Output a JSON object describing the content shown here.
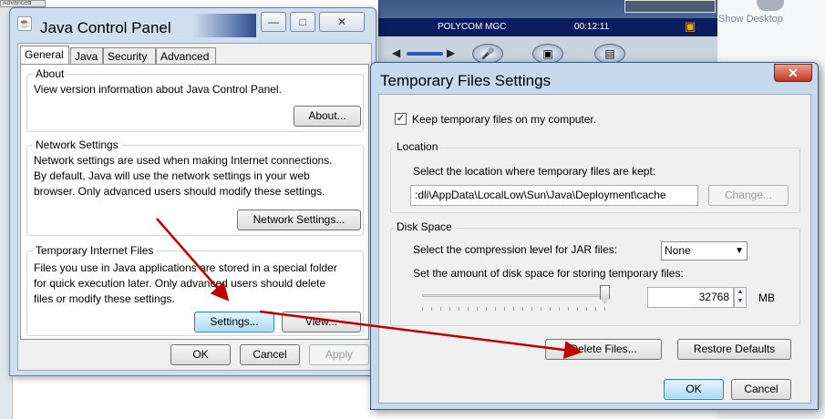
{
  "background": {
    "left_tab_label": "Advanced",
    "video_call_name": "POLYCOM MGC",
    "video_call_time": "00:12:11",
    "show_desktop_label": "Show Desktop"
  },
  "java_control_panel": {
    "title": "Java Control Panel",
    "tabs": [
      {
        "label": "General",
        "active": true
      },
      {
        "label": "Java",
        "active": false
      },
      {
        "label": "Security",
        "active": false
      },
      {
        "label": "Advanced",
        "active": false
      }
    ],
    "about": {
      "heading": "About",
      "text": "View version information about Java Control Panel.",
      "button": "About..."
    },
    "network": {
      "heading": "Network Settings",
      "text_lines": [
        "Network settings are used when making Internet connections.",
        "By default, Java will use the network settings in your web",
        "browser.  Only advanced users should modify these settings."
      ],
      "button": "Network Settings..."
    },
    "temp_files": {
      "heading": "Temporary Internet Files",
      "text_lines": [
        "Files you use in Java applications are stored in a special folder",
        "for quick execution later.  Only advanced users should delete",
        "files or modify these settings."
      ],
      "settings_button": "Settings...",
      "view_button": "View..."
    },
    "footer": {
      "ok": "OK",
      "cancel": "Cancel",
      "apply": "Apply"
    }
  },
  "temporary_files_dialog": {
    "title": "Temporary Files Settings",
    "keep_files_label": "Keep temporary files on my computer.",
    "keep_files_checked": true,
    "location": {
      "legend": "Location",
      "prompt": "Select the location where temporary files are kept:",
      "path": ":dli\\AppData\\LocalLow\\Sun\\Java\\Deployment\\cache",
      "change_button": "Change..."
    },
    "disk_space": {
      "legend": "Disk Space",
      "compression_label": "Select the compression level for JAR files:",
      "compression_value": "None",
      "amount_label": "Set the amount of disk space for storing temporary files:",
      "slider_level": 0.97,
      "amount_value": "32768",
      "unit": "MB"
    },
    "delete_button": "Delete Files...",
    "restore_button": "Restore Defaults",
    "ok": "OK",
    "cancel": "Cancel"
  },
  "colors": {
    "arrow": "#c00000",
    "window_frame": "#cfdff0",
    "focus_button": "#a7d9f5"
  }
}
